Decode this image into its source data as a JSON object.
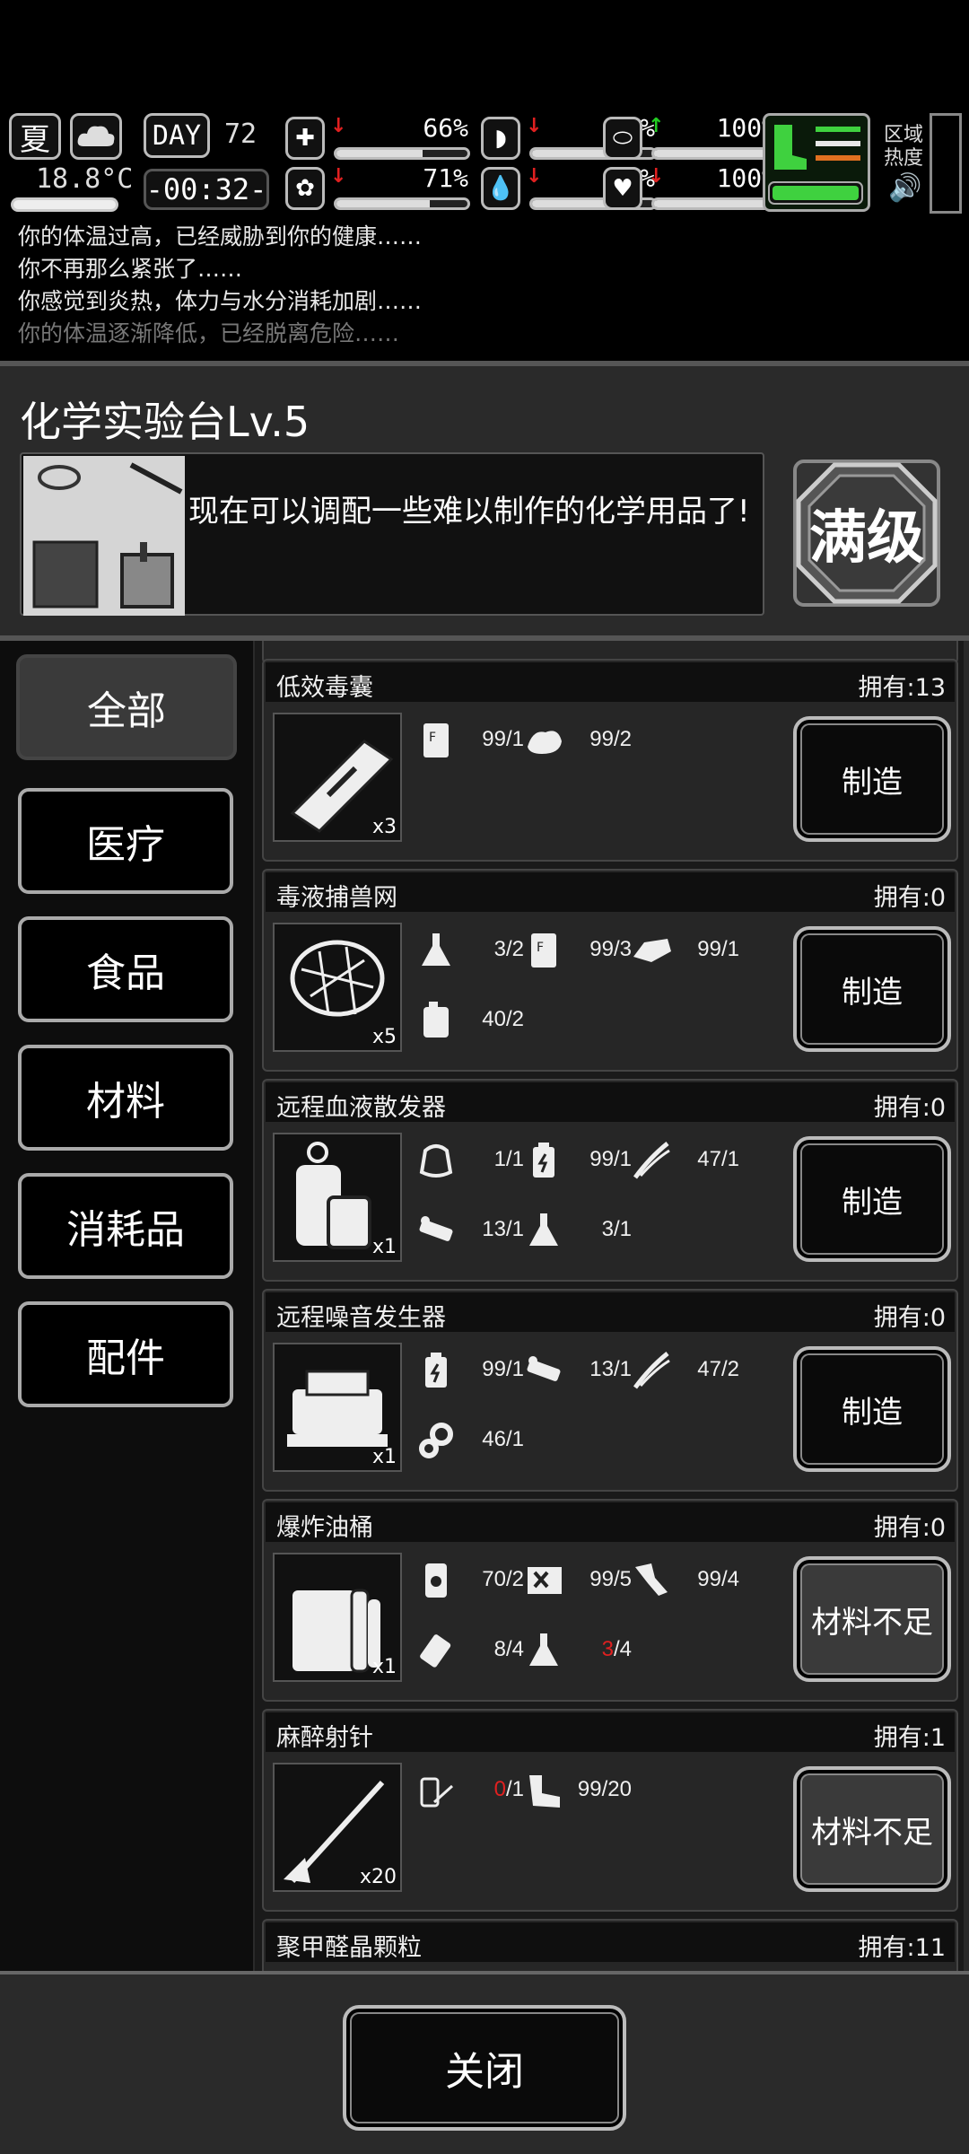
{
  "hud": {
    "season": "夏",
    "temperature": "18.8°C",
    "day_label": "DAY",
    "day_number": "72",
    "time": "-00:32-",
    "stats": [
      {
        "icon": "medkit-icon",
        "arrow": "↓",
        "arrow_color": "red",
        "value": "66%",
        "level": 0.66
      },
      {
        "icon": "stomach-icon",
        "arrow": "↓",
        "arrow_color": "red",
        "value": "60%",
        "level": 0.6
      },
      {
        "icon": "capsule-icon",
        "arrow": "↑",
        "arrow_color": "green",
        "value": "100%",
        "level": 1.0
      },
      {
        "icon": "brain-icon",
        "arrow": "↓",
        "arrow_color": "red",
        "value": "71%",
        "level": 0.71
      },
      {
        "icon": "water-drop-icon",
        "arrow": "↓",
        "arrow_color": "red",
        "value": "68%",
        "level": 0.68
      },
      {
        "icon": "heart-icon",
        "arrow": "↓",
        "arrow_color": "red",
        "value": "100%",
        "level": 1.0
      },
      {
        "icon": "stamina-icon",
        "arrow": "↑",
        "arrow_color": "green",
        "value": "100%",
        "level": 1.0
      }
    ],
    "region_label_1": "区域",
    "region_label_2": "热度"
  },
  "log": [
    "你的体温过高，已经威胁到你的健康……",
    "你不再那么紧张了……",
    "你感觉到炎热，体力与水分消耗加剧……",
    "你的体温逐渐降低，已经脱离危险……"
  ],
  "panel": {
    "title": "化学实验台Lv.5",
    "description": "现在可以调配一些难以制作的化学用品了!",
    "max_level_label": "满级"
  },
  "categories": [
    "全部",
    "医疗",
    "食品",
    "材料",
    "消耗品",
    "配件"
  ],
  "recipes": [
    {
      "name": "低效毒囊",
      "owned": "拥有:13",
      "qty": "x3",
      "button": "制造",
      "enabled": true,
      "materials": [
        {
          "icon": "flour-bag-icon",
          "have": "99",
          "need": "1"
        },
        {
          "icon": "cloth-icon",
          "have": "99",
          "need": "2"
        }
      ]
    },
    {
      "name": "毒液捕兽网",
      "owned": "拥有:0",
      "qty": "x5",
      "button": "制造",
      "enabled": true,
      "materials": [
        {
          "icon": "flask-icon",
          "have": "3",
          "need": "2"
        },
        {
          "icon": "flour-bag-icon",
          "have": "99",
          "need": "3"
        },
        {
          "icon": "rag-icon",
          "have": "99",
          "need": "1"
        },
        {
          "icon": "jerrycan-icon",
          "have": "40",
          "need": "2"
        }
      ]
    },
    {
      "name": "远程血液散发器",
      "owned": "拥有:0",
      "qty": "x1",
      "button": "制造",
      "enabled": true,
      "materials": [
        {
          "icon": "pouch-icon",
          "have": "1",
          "need": "1"
        },
        {
          "icon": "battery-icon",
          "have": "99",
          "need": "1"
        },
        {
          "icon": "wire-icon",
          "have": "47",
          "need": "1"
        },
        {
          "icon": "circuit-parts-icon",
          "have": "13",
          "need": "1"
        },
        {
          "icon": "flask-icon",
          "have": "3",
          "need": "1"
        }
      ]
    },
    {
      "name": "远程噪音发生器",
      "owned": "拥有:0",
      "qty": "x1",
      "button": "制造",
      "enabled": true,
      "materials": [
        {
          "icon": "battery-icon",
          "have": "99",
          "need": "1"
        },
        {
          "icon": "circuit-parts-icon",
          "have": "13",
          "need": "1"
        },
        {
          "icon": "wire-icon",
          "have": "47",
          "need": "2"
        },
        {
          "icon": "gears-icon",
          "have": "46",
          "need": "1"
        }
      ]
    },
    {
      "name": "爆炸油桶",
      "owned": "拥有:0",
      "qty": "x1",
      "button": "材料不足",
      "enabled": false,
      "materials": [
        {
          "icon": "oil-barrel-icon",
          "have": "70",
          "need": "2"
        },
        {
          "icon": "crate-icon",
          "have": "99",
          "need": "5"
        },
        {
          "icon": "glue-icon",
          "have": "99",
          "need": "4"
        },
        {
          "icon": "tape-icon",
          "have": "8",
          "need": "4"
        },
        {
          "icon": "flask-icon",
          "have": "3",
          "need": "4",
          "short": true
        }
      ]
    },
    {
      "name": "麻醉射针",
      "owned": "拥有:1",
      "qty": "x20",
      "button": "材料不足",
      "enabled": false,
      "materials": [
        {
          "icon": "syringe-vial-icon",
          "have": "0",
          "need": "1",
          "short": true
        },
        {
          "icon": "pipe-icon",
          "have": "99",
          "need": "20"
        }
      ]
    },
    {
      "name": "聚甲醛晶颗粒",
      "owned": "拥有:11",
      "qty": "",
      "button": "",
      "enabled": true,
      "materials": []
    }
  ],
  "close_label": "关闭",
  "colors": {
    "short": "#e02020",
    "gain": "#22cc22",
    "loss": "#e02020"
  }
}
